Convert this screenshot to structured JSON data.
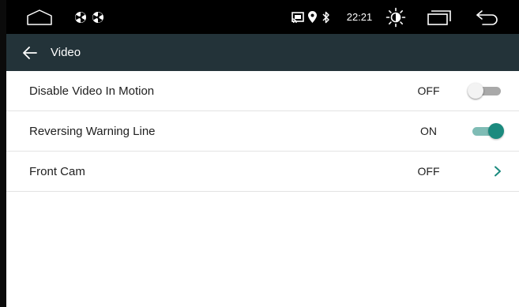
{
  "statusbar": {
    "time": "22:21",
    "icons": {
      "home": "home-outline-icon",
      "left_1": "pinwheel-icon",
      "left_2": "pinwheel-icon",
      "cast": "cast-icon",
      "location": "location-pin-icon",
      "bluetooth": "bluetooth-icon",
      "brightness": "brightness-icon",
      "recents": "recent-apps-icon",
      "back": "back-return-icon"
    }
  },
  "header": {
    "title": "Video",
    "back_icon": "arrow-left-icon"
  },
  "settings": [
    {
      "label": "Disable Video In Motion",
      "value": "OFF",
      "control": "toggle",
      "state": "off"
    },
    {
      "label": "Reversing Warning Line",
      "value": "ON",
      "control": "toggle",
      "state": "on"
    },
    {
      "label": "Front Cam",
      "value": "OFF",
      "control": "chevron"
    }
  ],
  "colors": {
    "statusbar_bg": "#000000",
    "header_bg": "#233339",
    "accent": "#1b8a7e",
    "accent_track": "#7fbcb5",
    "chevron": "#1b8a7e"
  }
}
